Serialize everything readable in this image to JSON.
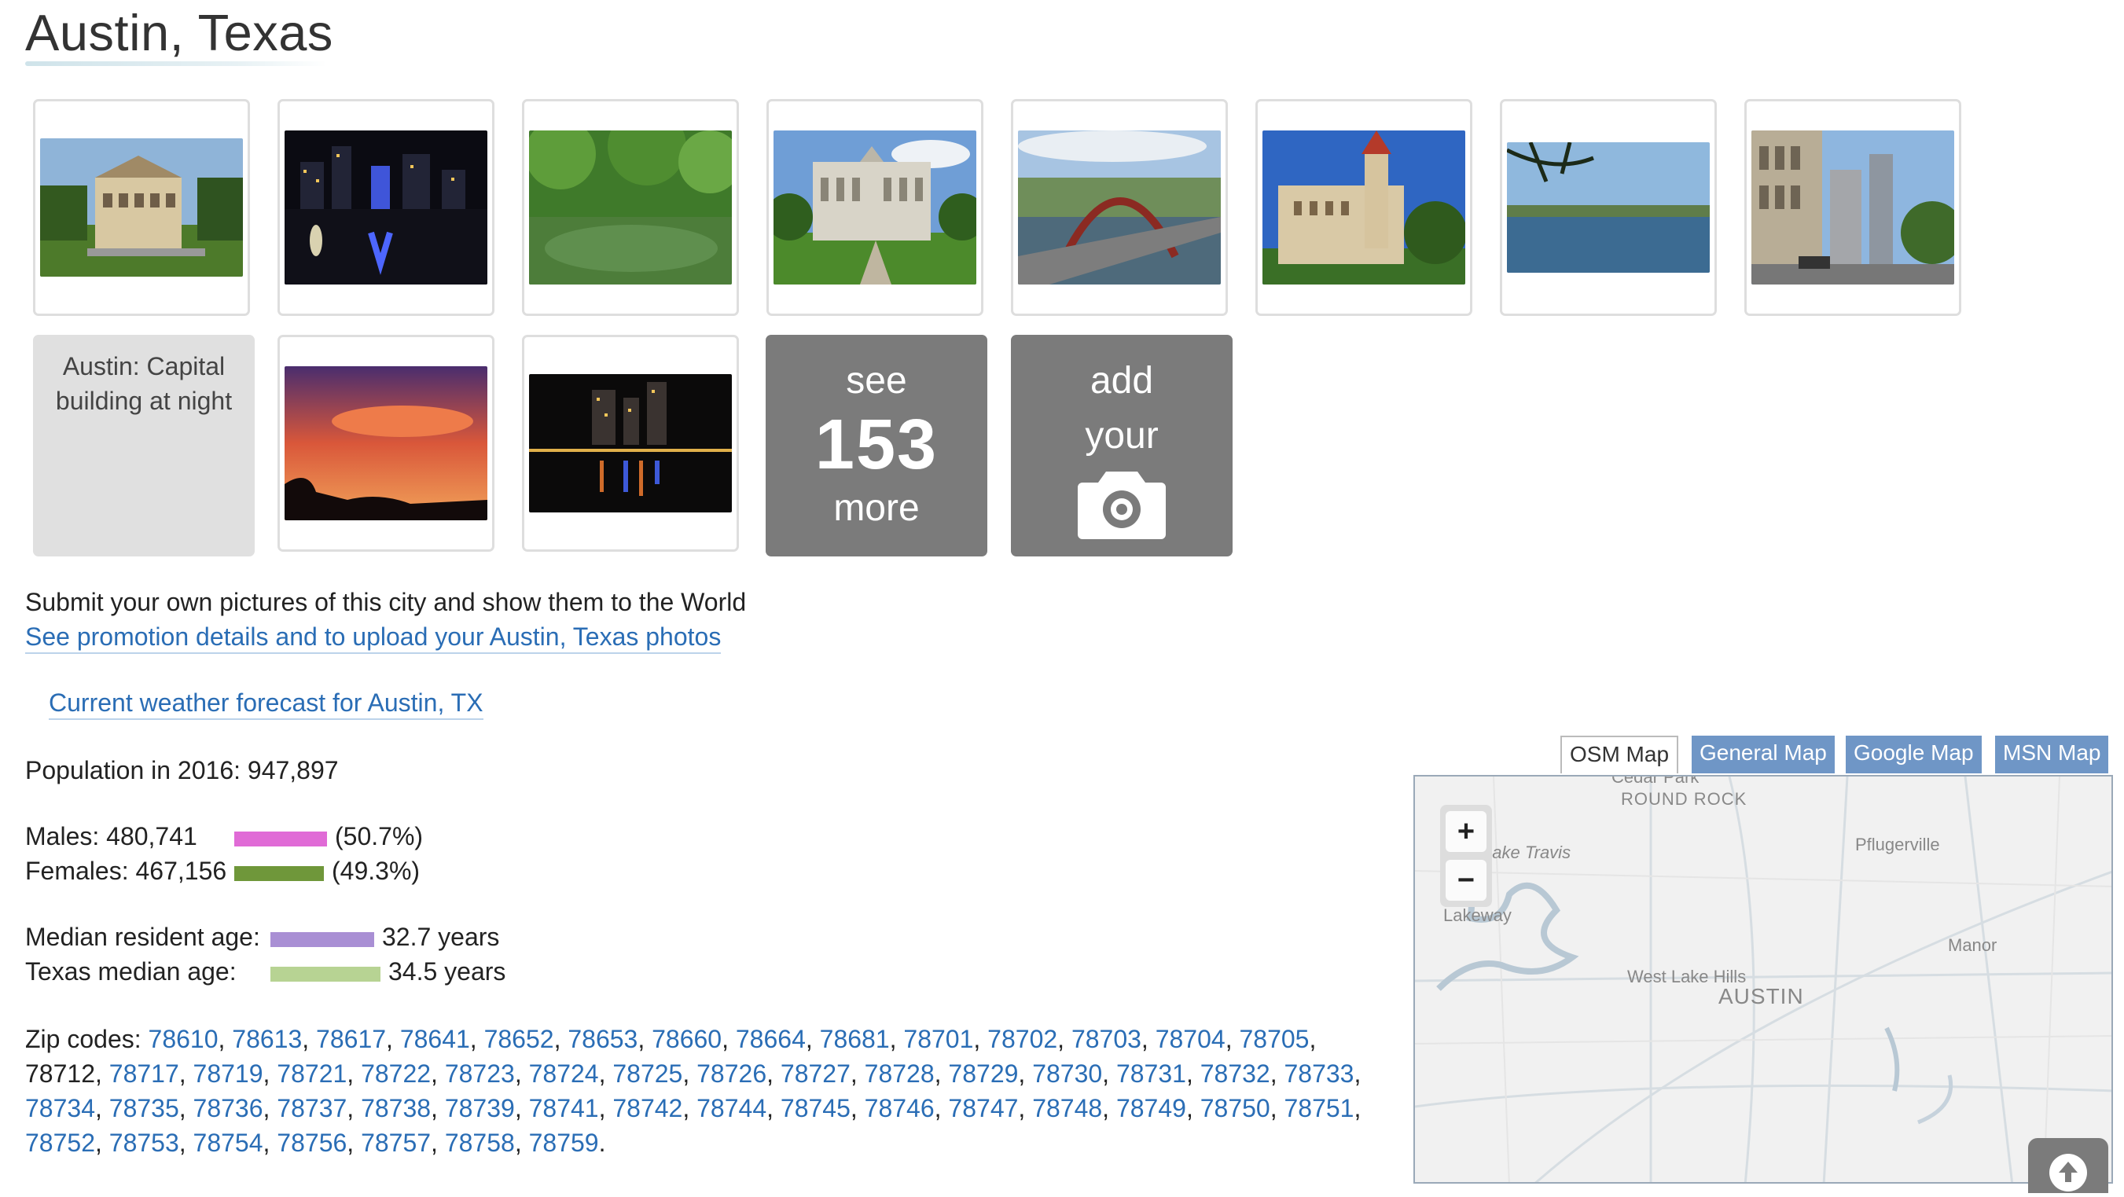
{
  "page": {
    "title": "Austin, Texas"
  },
  "gallery": {
    "caption_tile": "Austin: Capital building at night",
    "see_more": {
      "line1": "see",
      "count": "153",
      "line2": "more"
    },
    "add_photo": {
      "line1": "add",
      "line2": "your"
    }
  },
  "submit_text": "Submit your own pictures of this city and show them to the World",
  "promo_link": "See promotion details and to upload your Austin, Texas photos",
  "weather_link": "Current weather forecast for Austin, TX",
  "population": {
    "label": "Population in 2016:",
    "value": "947,897"
  },
  "gender": {
    "males_label": "Males:",
    "males_value": "480,741",
    "males_pct": "(50.7%)",
    "males_fraction": 0.507,
    "males_color": "#e06bd6",
    "females_label": "Females:",
    "females_value": "467,156",
    "females_pct": "(49.3%)",
    "females_fraction": 0.493,
    "females_color": "#6f973a"
  },
  "age": {
    "median_label": "Median resident age:",
    "median_value": "32.7 years",
    "median_color": "#a98fd4",
    "state_label": "Texas median age:",
    "state_value": "34.5 years",
    "state_color": "#b7d393"
  },
  "zip": {
    "label": "Zip codes:",
    "codes": [
      {
        "code": "78610",
        "link": true
      },
      {
        "code": "78613",
        "link": true
      },
      {
        "code": "78617",
        "link": true
      },
      {
        "code": "78641",
        "link": true
      },
      {
        "code": "78652",
        "link": true
      },
      {
        "code": "78653",
        "link": true
      },
      {
        "code": "78660",
        "link": true
      },
      {
        "code": "78664",
        "link": true
      },
      {
        "code": "78681",
        "link": true
      },
      {
        "code": "78701",
        "link": true
      },
      {
        "code": "78702",
        "link": true
      },
      {
        "code": "78703",
        "link": true
      },
      {
        "code": "78704",
        "link": true
      },
      {
        "code": "78705",
        "link": true
      },
      {
        "code": "78712",
        "link": false
      },
      {
        "code": "78717",
        "link": true
      },
      {
        "code": "78719",
        "link": true
      },
      {
        "code": "78721",
        "link": true
      },
      {
        "code": "78722",
        "link": true
      },
      {
        "code": "78723",
        "link": true
      },
      {
        "code": "78724",
        "link": true
      },
      {
        "code": "78725",
        "link": true
      },
      {
        "code": "78726",
        "link": true
      },
      {
        "code": "78727",
        "link": true
      },
      {
        "code": "78728",
        "link": true
      },
      {
        "code": "78729",
        "link": true
      },
      {
        "code": "78730",
        "link": true
      },
      {
        "code": "78731",
        "link": true
      },
      {
        "code": "78732",
        "link": true
      },
      {
        "code": "78733",
        "link": true
      },
      {
        "code": "78734",
        "link": true
      },
      {
        "code": "78735",
        "link": true
      },
      {
        "code": "78736",
        "link": true
      },
      {
        "code": "78737",
        "link": true
      },
      {
        "code": "78738",
        "link": true
      },
      {
        "code": "78739",
        "link": true
      },
      {
        "code": "78741",
        "link": true
      },
      {
        "code": "78742",
        "link": true
      },
      {
        "code": "78744",
        "link": true
      },
      {
        "code": "78745",
        "link": true
      },
      {
        "code": "78746",
        "link": true
      },
      {
        "code": "78747",
        "link": true
      },
      {
        "code": "78748",
        "link": true
      },
      {
        "code": "78749",
        "link": true
      },
      {
        "code": "78750",
        "link": true
      },
      {
        "code": "78751",
        "link": true
      },
      {
        "code": "78752",
        "link": true
      },
      {
        "code": "78753",
        "link": true
      },
      {
        "code": "78754",
        "link": true
      },
      {
        "code": "78756",
        "link": true
      },
      {
        "code": "78757",
        "link": true
      },
      {
        "code": "78758",
        "link": true
      },
      {
        "code": "78759",
        "link": true
      }
    ]
  },
  "map": {
    "tabs": [
      "OSM Map",
      "General Map",
      "Google Map",
      "MSN Map"
    ],
    "active_tab": "OSM Map",
    "labels": {
      "round_rock": "ROUND ROCK",
      "pflugerville": "Pflugerville",
      "lake_travis": "Lake Travis",
      "lakeway": "Lakeway",
      "manor": "Manor",
      "west_lake_hills": "West Lake Hills",
      "austin": "AUSTIN",
      "cedar_park": "Cedar Park"
    },
    "zoom_in": "+",
    "zoom_out": "−"
  },
  "icons": {
    "camera": "camera-icon",
    "scroll_top": "arrow-up-circle-icon"
  }
}
